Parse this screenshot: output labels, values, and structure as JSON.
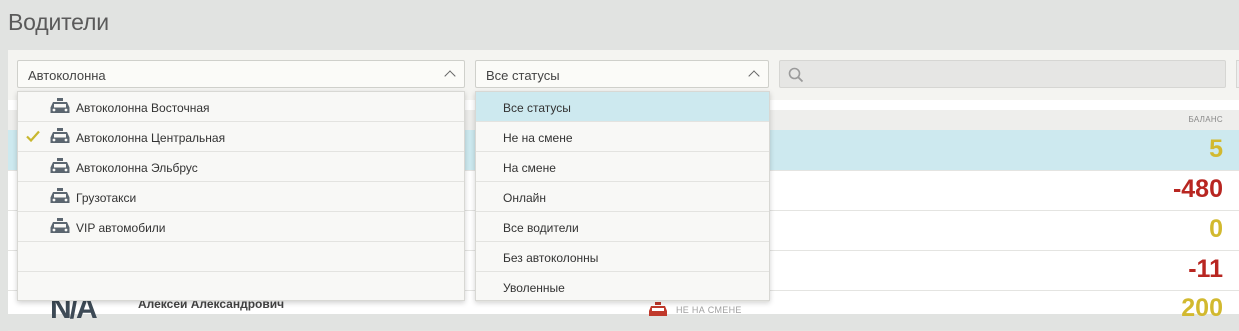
{
  "page": {
    "title": "Водители"
  },
  "filters": {
    "fleet_select": {
      "value": "Автоколонна"
    },
    "status_select": {
      "value": "Все статусы"
    },
    "search": {
      "placeholder": ""
    }
  },
  "fleet_dropdown": {
    "items": [
      {
        "label": "Автоколонна Восточная",
        "selected": false
      },
      {
        "label": "Автоколонна Центральная",
        "selected": true
      },
      {
        "label": "Автоколонна Эльбрус",
        "selected": false
      },
      {
        "label": "Грузотакси",
        "selected": false
      },
      {
        "label": "VIP автомобили",
        "selected": false
      }
    ]
  },
  "status_dropdown": {
    "items": [
      {
        "label": "Все статусы",
        "selected": true
      },
      {
        "label": "Не на смене",
        "selected": false
      },
      {
        "label": "На смене",
        "selected": false
      },
      {
        "label": "Онлайн",
        "selected": false
      },
      {
        "label": "Все водители",
        "selected": false
      },
      {
        "label": "Без автоколонны",
        "selected": false
      },
      {
        "label": "Уволенные",
        "selected": false
      }
    ]
  },
  "table": {
    "balance_header": "БАЛАНС",
    "rows": [
      {
        "balance": "5",
        "color": "#d2b92f",
        "selected": true
      },
      {
        "balance": "-480",
        "color": "#b82621",
        "selected": false
      },
      {
        "balance": "0",
        "color": "#d2b92f",
        "selected": false
      },
      {
        "balance": "-11",
        "color": "#b82621",
        "selected": false
      },
      {
        "balance": "200",
        "color": "#d2b92f",
        "selected": false
      }
    ],
    "partial_row": {
      "avatar": "N/A",
      "name": "Алексей Александрович",
      "status": "НЕ НА СМЕНЕ"
    }
  },
  "colors": {
    "accent_selected": "#cde9ef",
    "check": "#c8b72e",
    "status_car": "#c0392b"
  }
}
